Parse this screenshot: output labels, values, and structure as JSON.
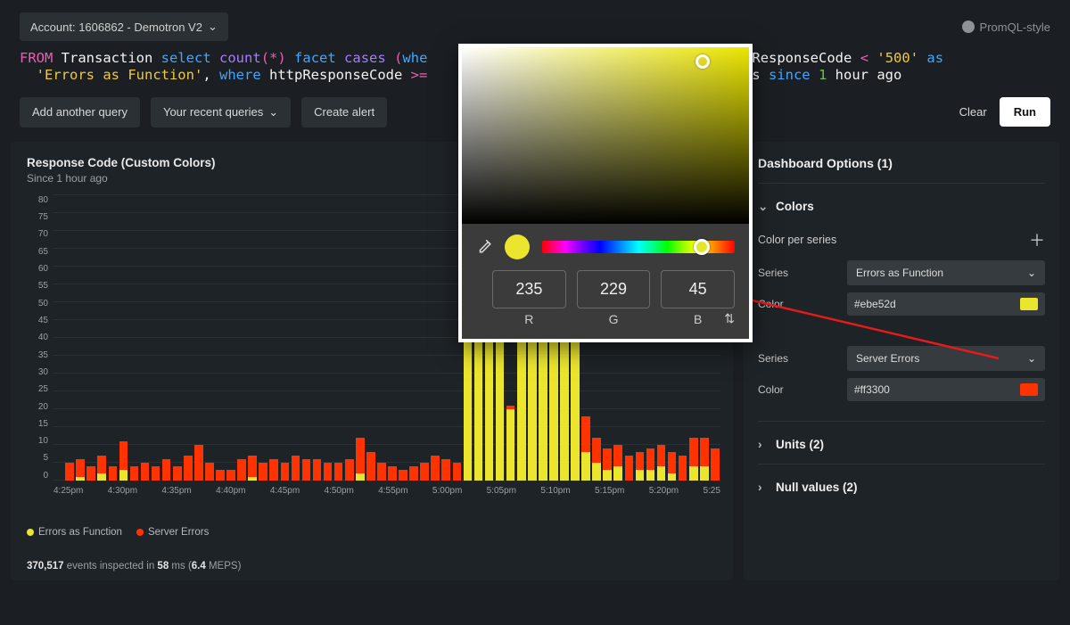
{
  "topbar": {
    "account_label": "Account: 1606862 - Demotron V2",
    "promql_label": "PromQL-style"
  },
  "query": {
    "line1": {
      "from": "FROM",
      "entity": "Transaction",
      "select": "select",
      "count": "count",
      "star": "(*)",
      "facet": "facet",
      "cases": "cases",
      "open": "(",
      "where1": "whe",
      "field": "httpResponseCode",
      "lt": "<",
      "val": "'500'",
      "as": "as"
    },
    "line2": {
      "alias": "'Errors as Function'",
      "comma": ",",
      "where": "where",
      "field": "httpResponseCode",
      "gte": ">=",
      "trail1": "ies",
      "since": "since",
      "num": "1",
      "hour": "hour",
      "ago": "ago"
    }
  },
  "toolbar": {
    "add_query": "Add another query",
    "recent": "Your recent queries",
    "create_alert": "Create alert",
    "clear": "Clear",
    "run": "Run"
  },
  "chart": {
    "title": "Response Code (Custom Colors)",
    "subtitle": "Since 1 hour ago",
    "legend_yellow": "Errors as Function",
    "legend_red": "Server Errors",
    "footer_count": "370,517",
    "footer_mid": " events inspected in ",
    "footer_ms": "58",
    "footer_ms_unit": " ms (",
    "footer_meps": "6.4",
    "footer_meps_unit": " MEPS)"
  },
  "chart_data": {
    "type": "bar",
    "title": "Response Code (Custom Colors)",
    "xlabel": "",
    "ylabel": "",
    "ylim": [
      0,
      80
    ],
    "yticks": [
      0,
      5,
      10,
      15,
      20,
      25,
      30,
      35,
      40,
      45,
      50,
      55,
      60,
      65,
      70,
      75,
      80
    ],
    "xticks": [
      "4:25pm",
      "4:30pm",
      "4:35pm",
      "4:40pm",
      "4:45pm",
      "4:50pm",
      "4:55pm",
      "5:00pm",
      "5:05pm",
      "5:10pm",
      "5:15pm",
      "5:20pm",
      "5:25"
    ],
    "series": [
      {
        "name": "Errors as Function",
        "color": "#ebe52d",
        "values": [
          0,
          0,
          1,
          0,
          2,
          0,
          3,
          0,
          0,
          0,
          0,
          0,
          0,
          0,
          0,
          0,
          0,
          0,
          1,
          0,
          0,
          0,
          0,
          0,
          0,
          0,
          0,
          0,
          2,
          0,
          0,
          0,
          0,
          0,
          0,
          0,
          0,
          0,
          65,
          64,
          63,
          47,
          20,
          64,
          64,
          65,
          40,
          62,
          62,
          8,
          5,
          3,
          4,
          0,
          3,
          3,
          4,
          2,
          0,
          4,
          4,
          0
        ]
      },
      {
        "name": "Server Errors",
        "color": "#ff3300",
        "values": [
          0,
          5,
          5,
          4,
          5,
          4,
          8,
          4,
          5,
          4,
          6,
          4,
          7,
          10,
          5,
          3,
          3,
          6,
          6,
          5,
          6,
          5,
          7,
          6,
          6,
          5,
          5,
          6,
          10,
          8,
          5,
          4,
          3,
          4,
          5,
          7,
          6,
          5,
          2,
          2,
          2,
          1,
          1,
          1,
          1,
          1,
          1,
          1,
          2,
          10,
          7,
          6,
          6,
          7,
          5,
          6,
          6,
          6,
          7,
          8,
          8,
          9
        ]
      }
    ]
  },
  "sidepanel": {
    "title": "Dashboard Options (1)",
    "colors_head": "Colors",
    "cps_label": "Color per series",
    "series_lbl": "Series",
    "color_lbl": "Color",
    "series1_sel": "Errors as Function",
    "color1_val": "#ebe52d",
    "series2_sel": "Server Errors",
    "color2_val": "#ff3300",
    "units_head": "Units (2)",
    "null_head": "Null values (2)"
  },
  "picker": {
    "r": "235",
    "g": "229",
    "b": "45",
    "r_lbl": "R",
    "g_lbl": "G",
    "b_lbl": "B"
  }
}
